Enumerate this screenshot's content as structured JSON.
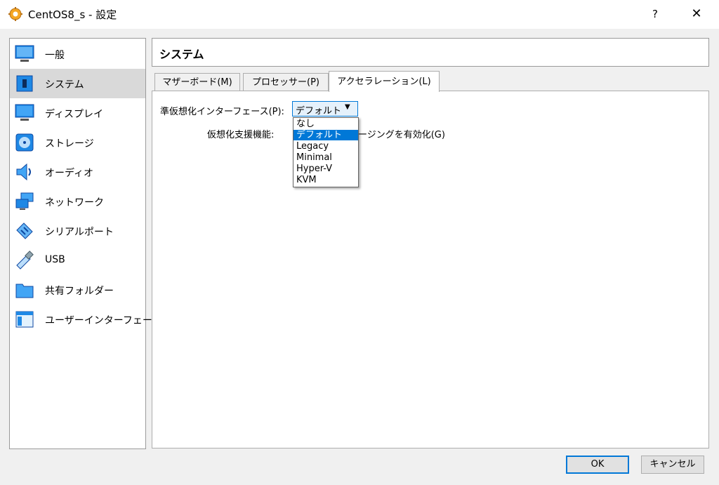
{
  "window": {
    "title": "CentOS8_s - 設定",
    "help": "?",
    "close": "✕"
  },
  "sidebar": {
    "items": [
      {
        "label": "一般",
        "icon": "monitor-icon"
      },
      {
        "label": "システム",
        "icon": "chip-icon"
      },
      {
        "label": "ディスプレイ",
        "icon": "display-icon"
      },
      {
        "label": "ストレージ",
        "icon": "disk-icon"
      },
      {
        "label": "オーディオ",
        "icon": "speaker-icon"
      },
      {
        "label": "ネットワーク",
        "icon": "network-icon"
      },
      {
        "label": "シリアルポート",
        "icon": "serial-port-icon"
      },
      {
        "label": "USB",
        "icon": "usb-icon"
      },
      {
        "label": "共有フォルダー",
        "icon": "folder-icon"
      },
      {
        "label": "ユーザーインターフェース",
        "icon": "window-icon"
      }
    ],
    "selected": "システム"
  },
  "section": {
    "title": "システム"
  },
  "tabs": [
    {
      "label": "マザーボード(M)"
    },
    {
      "label": "プロセッサー(P)"
    },
    {
      "label": "アクセラレーション(L)"
    }
  ],
  "active_tab": "アクセラレーション(L)",
  "acceleration": {
    "paravirt_label": "準仮想化インターフェース(P):",
    "paravirt_value": "デフォルト",
    "paravirt_options": [
      "なし",
      "デフォルト",
      "Legacy",
      "Minimal",
      "Hyper-V",
      "KVM"
    ],
    "hw_virt_label": "仮想化支援機能:",
    "nested_paging_label": "ージングを有効化(G)"
  },
  "buttons": {
    "ok": "OK",
    "cancel": "キャンセル"
  },
  "colors": {
    "accent": "#0078d7",
    "selected_nav": "#d9d9d9"
  }
}
